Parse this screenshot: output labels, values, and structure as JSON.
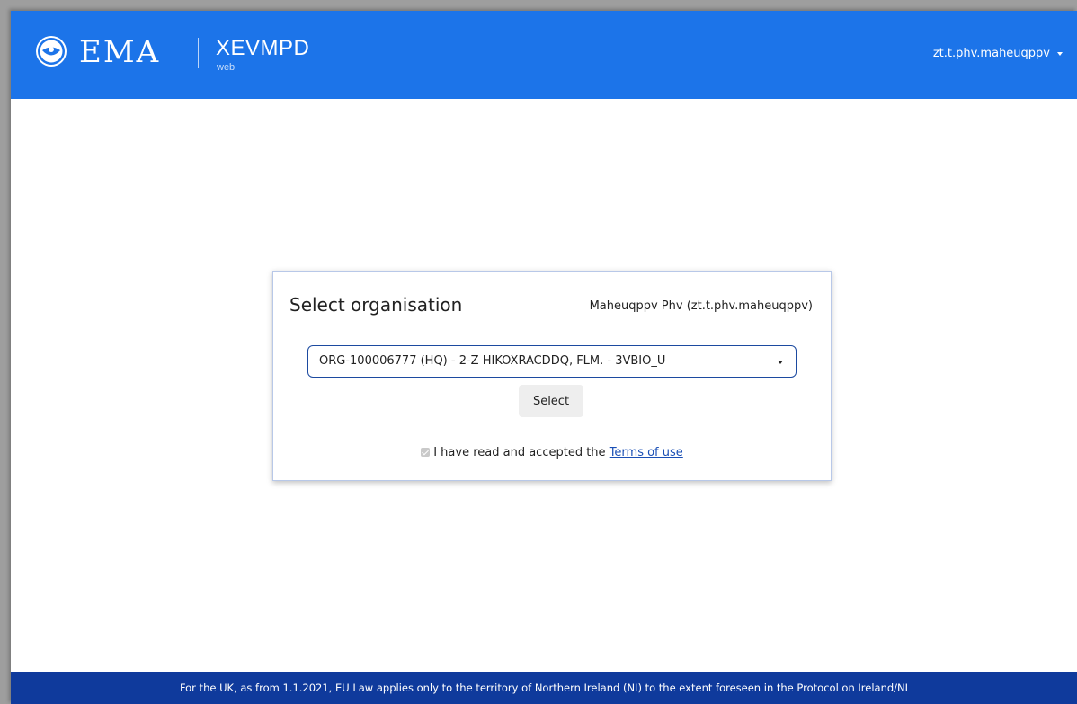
{
  "header": {
    "brand": "EMA",
    "app_title": "XEVMPD",
    "app_subtitle": "web",
    "user_menu_label": "zt.t.phv.maheuqppv",
    "logo_icon": "ema-logo-icon",
    "background_color": "#1c74e9"
  },
  "card": {
    "title": "Select organisation",
    "user_display": "Maheuqppv Phv (zt.t.phv.maheuqppv)",
    "organisation_select": {
      "selected_value": "ORG-100006777 (HQ) - 2-Z HIKOXRACDDQ, FLM. - 3VBIO_U"
    },
    "select_button_label": "Select",
    "terms": {
      "checked": true,
      "prefix_text": "I have read and accepted the",
      "link_text": "Terms of use"
    }
  },
  "footer": {
    "text": "For the UK, as from 1.1.2021, EU Law applies only to the territory of Northern Ireland (NI) to the extent foreseen in the Protocol on Ireland/NI",
    "background_color": "#0f3a9c"
  }
}
